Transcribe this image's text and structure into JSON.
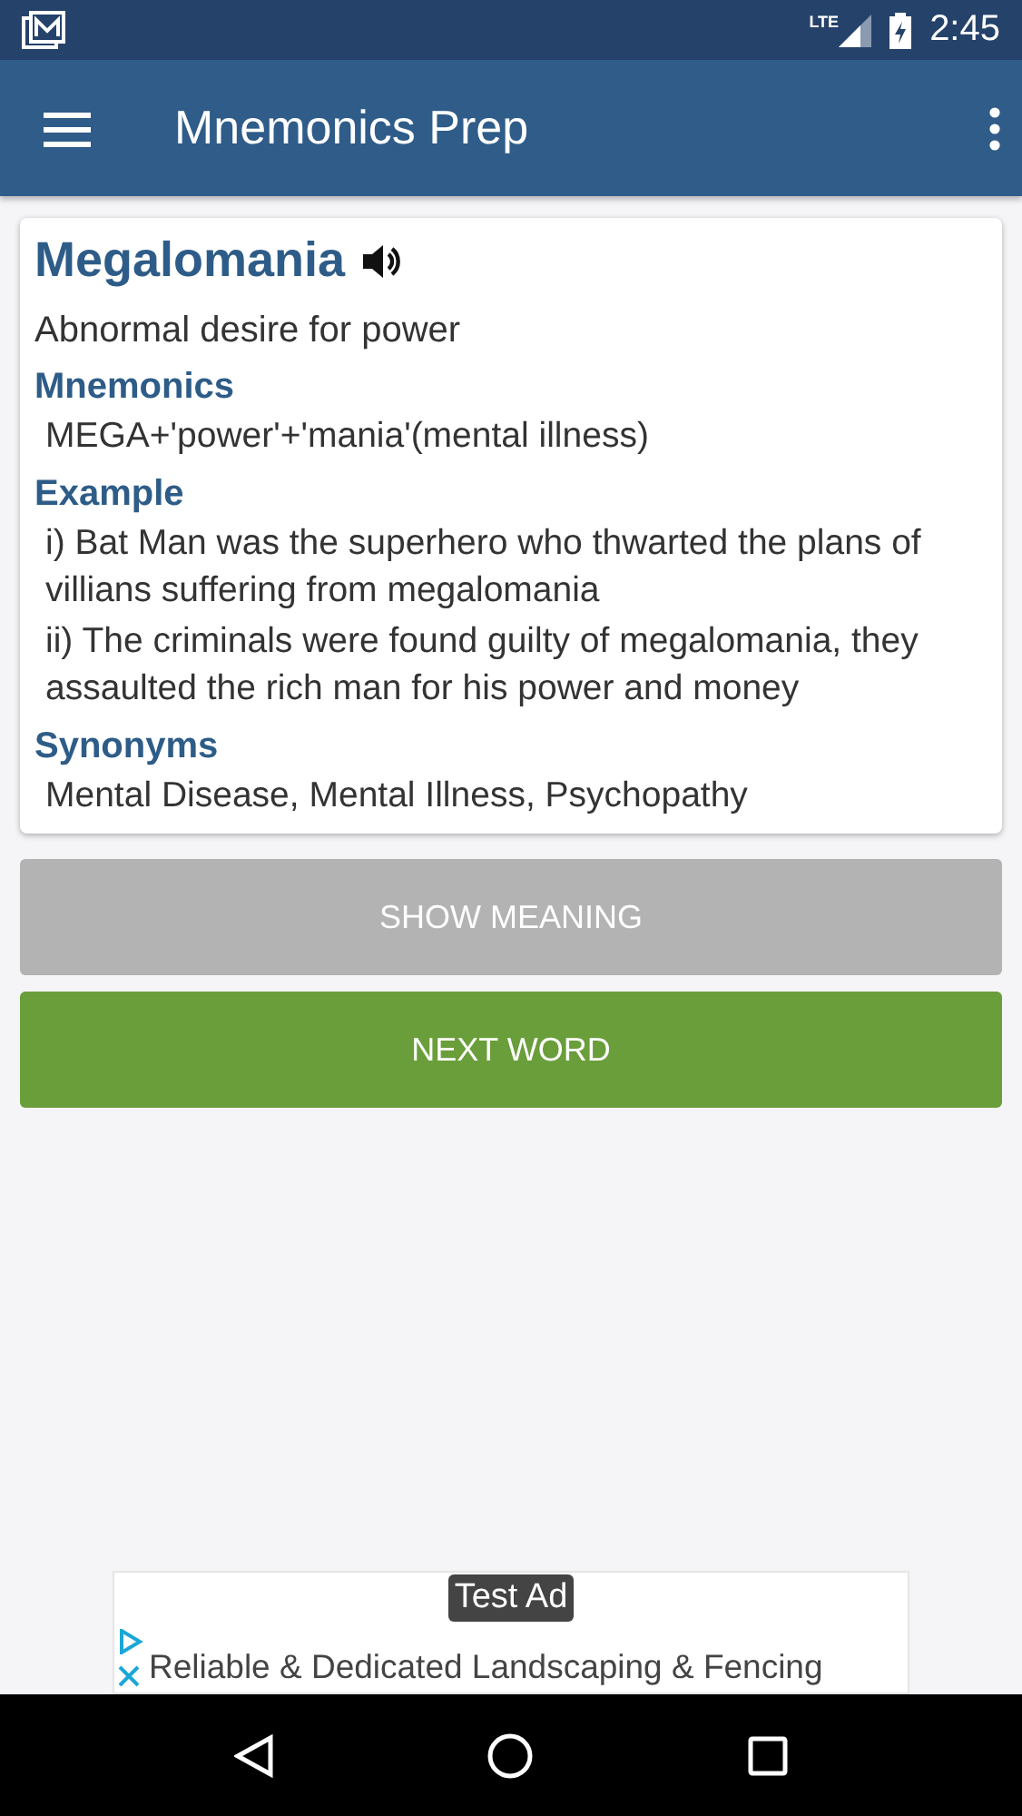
{
  "status_bar": {
    "network": "LTE",
    "time": "2:45"
  },
  "app_bar": {
    "title": "Mnemonics Prep"
  },
  "card": {
    "word": "Megalomania",
    "definition": "Abnormal desire for power",
    "sections": [
      {
        "heading": "Mnemonics",
        "lines": [
          "MEGA+'power'+'mania'(mental illness)"
        ]
      },
      {
        "heading": "Example",
        "lines": [
          "i) Bat Man was the superhero who thwarted the plans of villians suffering from megalomania",
          "ii) The criminals were found guilty of megalomania, they assaulted the rich man for his power and money"
        ]
      },
      {
        "heading": "Synonyms",
        "lines": [
          "Mental Disease, Mental Illness, Psychopathy"
        ]
      }
    ]
  },
  "buttons": [
    {
      "label": "SHOW MEANING",
      "kind": "secondary"
    },
    {
      "label": "NEXT WORD",
      "kind": "primary"
    }
  ],
  "ad": {
    "badge": "Test Ad",
    "text": "Reliable & Dedicated Landscaping & Fencing"
  }
}
